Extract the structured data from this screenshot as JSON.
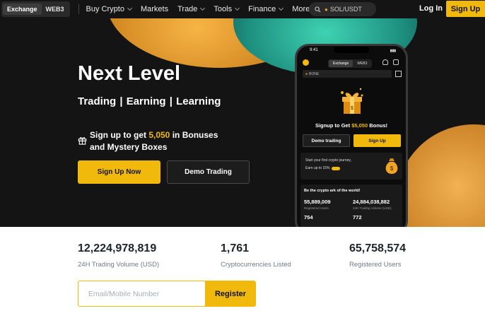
{
  "nav": {
    "segment": [
      "Exchange",
      "WEB3"
    ],
    "menu": [
      {
        "label": "Buy Crypto",
        "has_dropdown": true
      },
      {
        "label": "Markets",
        "has_dropdown": false
      },
      {
        "label": "Trade",
        "has_dropdown": true
      },
      {
        "label": "Tools",
        "has_dropdown": true
      },
      {
        "label": "Finance",
        "has_dropdown": true
      },
      {
        "label": "More",
        "has_dropdown": true
      }
    ],
    "search_value": "SOL/USDT",
    "login": "Log In",
    "signup": "Sign Up"
  },
  "hero": {
    "title": "Next Level",
    "subtitle": "Trading | Earning | Learning",
    "bonus_pre": "Sign up to get ",
    "bonus_amount": "5,050",
    "bonus_post": " in Bonuses",
    "bonus_line2": "and Mystery Boxes",
    "primary_button": "Sign Up Now",
    "secondary_button": "Demo Trading"
  },
  "phone": {
    "time": "9:41",
    "segment": [
      "Exchange",
      "WEB3"
    ],
    "search_value": "BONE",
    "signup_pre": "Signup to Get ",
    "signup_amount": "$5,050",
    "signup_post": " Bonus!",
    "demo_button": "Demo trading",
    "signup_button": "Sign Up",
    "card1_line1": "Start your first crypto journey,",
    "card1_line2": "Earn up to 15%",
    "card2_heading": "Be the crypto ark of the world!",
    "stats": [
      {
        "value": "55,889,009",
        "label": "Registered Users"
      },
      {
        "value": "24,884,038,882",
        "label": "24H Trading Volume (USD)"
      },
      {
        "value": "754",
        "label": ""
      },
      {
        "value": "772",
        "label": ""
      }
    ]
  },
  "stats": [
    {
      "value": "12,224,978,819",
      "label": "24H Trading Volume (USD)"
    },
    {
      "value": "1,761",
      "label": "Cryptocurrencies Listed"
    },
    {
      "value": "65,758,574",
      "label": "Registered Users"
    }
  ],
  "register": {
    "placeholder": "Email/Mobile Number",
    "button": "Register"
  },
  "colors": {
    "accent": "#f0b90b",
    "nav_bg": "#141414",
    "teal": "#3fd2b2"
  }
}
